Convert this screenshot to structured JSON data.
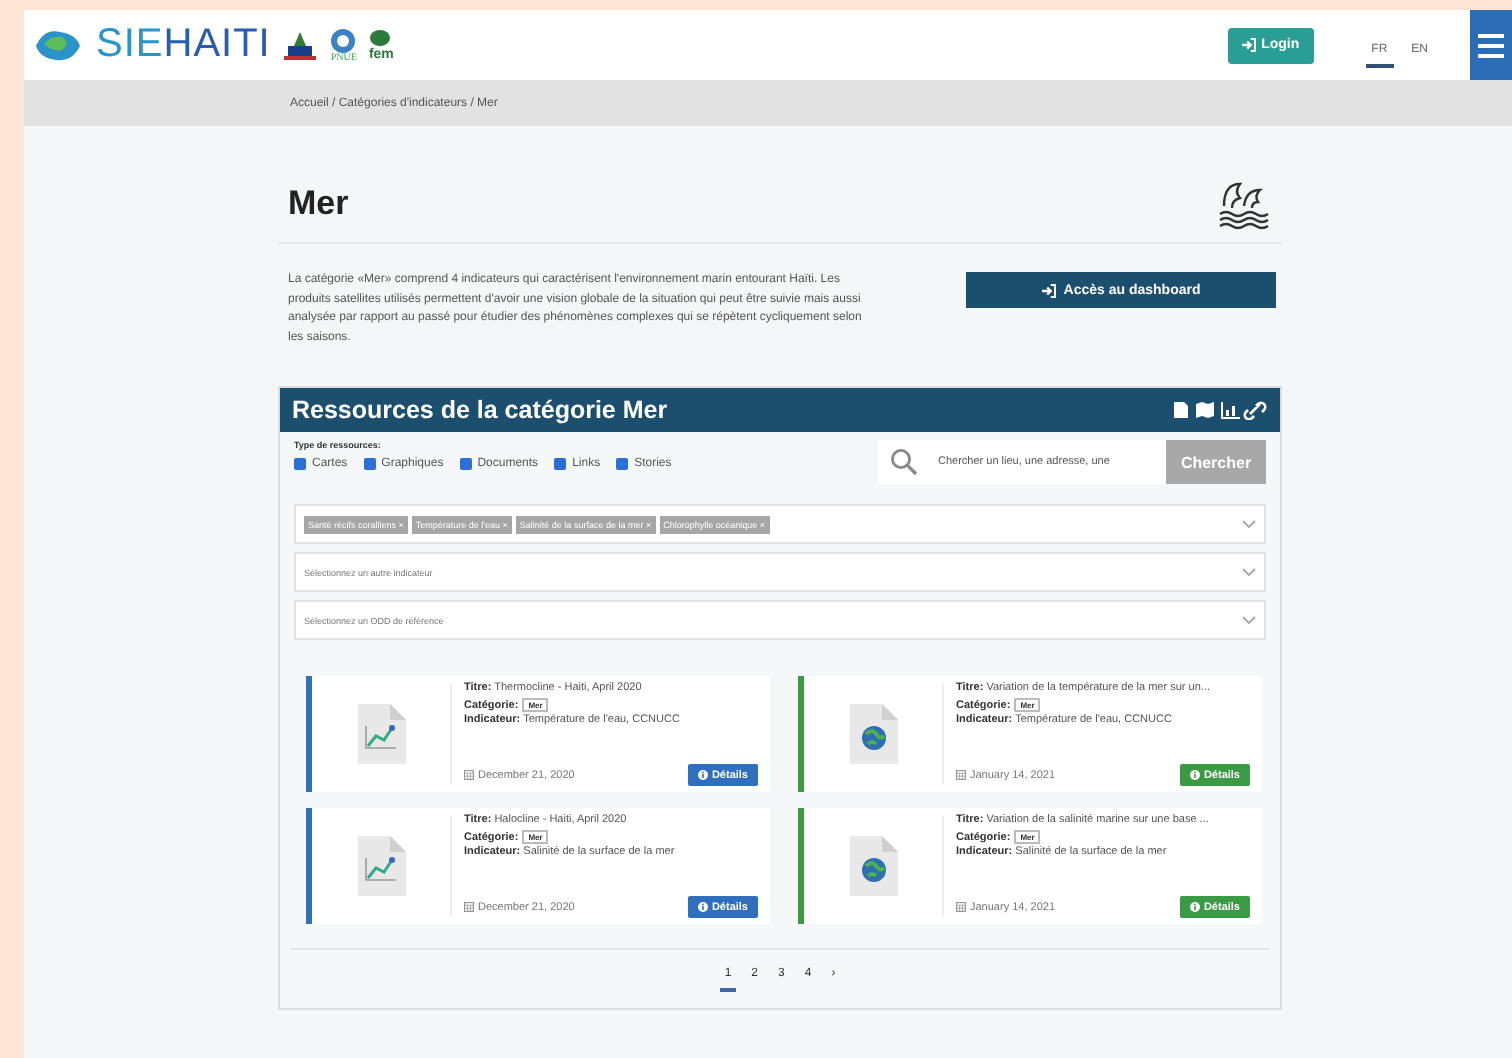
{
  "header": {
    "logo": {
      "prefix": "SIE",
      "suffix": "HAITI"
    },
    "partner_pnue": "PNUE",
    "partner_fem": "fem",
    "login": "Login",
    "languages": [
      {
        "label": "FR",
        "selected": true
      },
      {
        "label": "EN",
        "selected": false
      }
    ]
  },
  "breadcrumb": "Accueil / Catégories d'indicateurs / Mer",
  "page": {
    "title": "Mer",
    "description": "La catégorie «Mer» comprend 4 indicateurs qui caractérisent l'environnement marin entourant Haïti. Les produits satellites utilisés permettent d'avoir une vision globale de la situation qui peut être suivie mais aussi analysée par rapport au passé pour étudier des phénomènes complexes qui se répètent cycliquement selon les saisons.",
    "dashboard_button": "Accès au dashboard"
  },
  "resources": {
    "title": "Ressources de la catégorie Mer",
    "types_label": "Type de ressources:",
    "types": [
      {
        "label": "Cartes",
        "checked": true
      },
      {
        "label": "Graphiques",
        "checked": true
      },
      {
        "label": "Documents",
        "checked": true
      },
      {
        "label": "Links",
        "checked": true
      },
      {
        "label": "Stories",
        "checked": true
      }
    ],
    "search": {
      "placeholder": "Chercher un lieu, une adresse, une",
      "button": "Chercher"
    },
    "indicator_tags": [
      "Santé récifs coralliens ×",
      "Température de l'eau ×",
      "Salinité de la surface de la mer ×",
      "Chlorophylle océanique ×"
    ],
    "selects": [
      {
        "placeholder": "Sélectionnez un autre indicateur"
      },
      {
        "placeholder": "Sélectionnez un ODD de référence"
      }
    ],
    "cards": [
      {
        "kind": "chart",
        "color": "#2f6fbd",
        "title_label": "Titre:",
        "title": "Thermocline - Haiti, April 2020",
        "category_label": "Catégorie:",
        "category": "Mer",
        "indicator_label": "Indicateur:",
        "indicator": "Température de l'eau, CCNUCC",
        "date": "December 21, 2020",
        "details": "Détails"
      },
      {
        "kind": "map",
        "color": "#3a9b44",
        "title_label": "Titre:",
        "title": "Variation de la température de la mer sur un...",
        "category_label": "Catégorie:",
        "category": "Mer",
        "indicator_label": "Indicateur:",
        "indicator": "Température de l'eau, CCNUCC",
        "date": "January 14, 2021",
        "details": "Détails"
      },
      {
        "kind": "chart",
        "color": "#2f6fbd",
        "title_label": "Titre:",
        "title": "Halocline - Haiti, April 2020",
        "category_label": "Catégorie:",
        "category": "Mer",
        "indicator_label": "Indicateur:",
        "indicator": "Salinité de la surface de la mer",
        "date": "December 21, 2020",
        "details": "Détails"
      },
      {
        "kind": "map",
        "color": "#3a9b44",
        "title_label": "Titre:",
        "title": "Variation de la salinité marine sur une base ...",
        "category_label": "Catégorie:",
        "category": "Mer",
        "indicator_label": "Indicateur:",
        "indicator": "Salinité de la surface de la mer",
        "date": "January 14, 2021",
        "details": "Détails"
      }
    ],
    "pagination": [
      {
        "label": "1",
        "selected": true
      },
      {
        "label": "2",
        "selected": false
      },
      {
        "label": "3",
        "selected": false
      },
      {
        "label": "4",
        "selected": false
      }
    ],
    "next": "›"
  }
}
